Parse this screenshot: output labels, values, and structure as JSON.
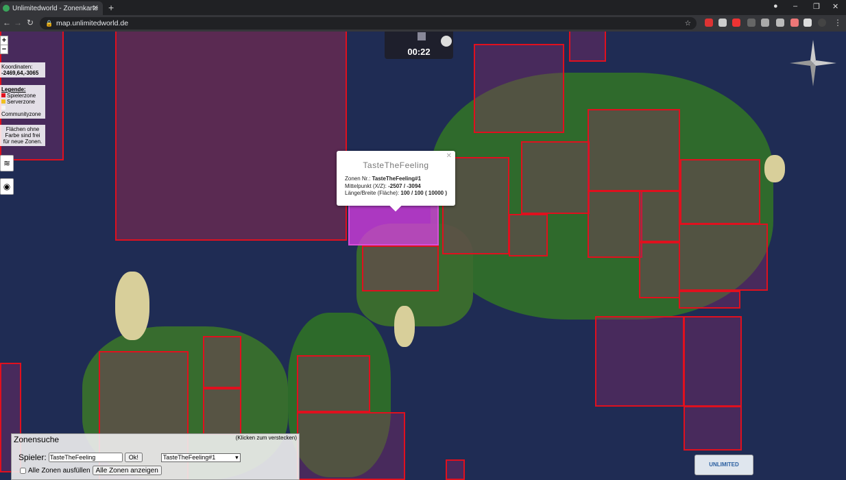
{
  "browser": {
    "tab_title": "Unlimitedworld - Zonenkarte",
    "url": "map.unlimitedworld.de"
  },
  "map": {
    "zoom_in": "+",
    "zoom_out": "−",
    "coords_label": "Koordinaten:",
    "coords_value": "-2469,64,-3065",
    "legend": {
      "title": "Legende:",
      "items": [
        {
          "label": "Spielerzone",
          "color": "#e0101e"
        },
        {
          "label": "Serverzone",
          "color": "#f0c020"
        },
        {
          "label": "Communityzone",
          "color": "#f4f4f4"
        }
      ],
      "note": [
        "Flächen ohne",
        "Farbe sind frei",
        "für neue Zonen."
      ]
    },
    "clock": "00:22"
  },
  "popup": {
    "title": "TasteTheFeeling",
    "zone_label": "Zonen Nr.:",
    "zone_value": "TasteTheFeeling#1",
    "center_label": "Mittelpunkt (X/Z):",
    "center_value": "-2507 / -3094",
    "size_label": "Länge/Breite (Fläche):",
    "size_value": "100 / 100 ( 10000 )"
  },
  "search": {
    "title": "Zonensuche",
    "hint": "(Klicken zum verstecken)",
    "player_label": "Spieler:",
    "player_value": "TasteTheFeeling",
    "ok_label": "Ok!",
    "zone_select": "TasteTheFeeling#1",
    "fill_all_label": "Alle Zonen ausfüllen",
    "show_all_label": "Alle Zonen anzeigen"
  },
  "logo": "UNLIMITED WORLD.DE"
}
